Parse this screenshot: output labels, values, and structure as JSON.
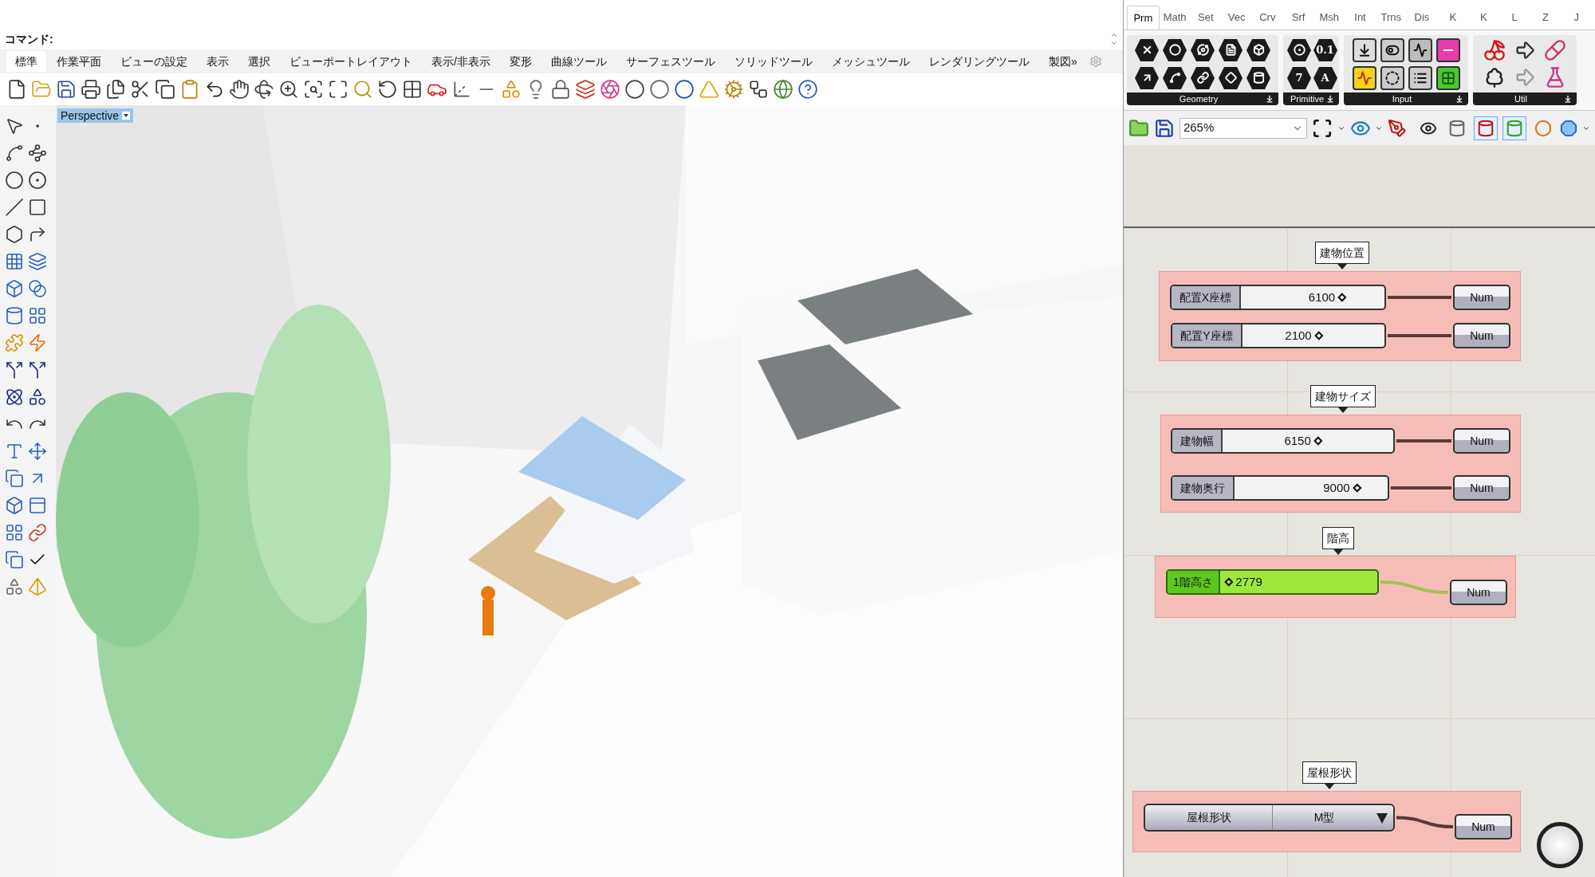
{
  "rhino": {
    "command_label": "コマンド:",
    "tabs": [
      {
        "label": "標準",
        "selected": true
      },
      {
        "label": "作業平面",
        "selected": false
      },
      {
        "label": "ビューの設定",
        "selected": false
      },
      {
        "label": "表示",
        "selected": false
      },
      {
        "label": "選択",
        "selected": false
      },
      {
        "label": "ビューポートレイアウト",
        "selected": false
      },
      {
        "label": "表示/非表示",
        "selected": false
      },
      {
        "label": "変形",
        "selected": false
      },
      {
        "label": "曲線ツール",
        "selected": false
      },
      {
        "label": "サーフェスツール",
        "selected": false
      },
      {
        "label": "ソリッドツール",
        "selected": false
      },
      {
        "label": "メッシュツール",
        "selected": false
      },
      {
        "label": "レンダリングツール",
        "selected": false
      },
      {
        "label": "製図»",
        "selected": false
      }
    ],
    "viewport": {
      "label": "Perspective"
    }
  },
  "grasshopper": {
    "tabs": [
      {
        "label": "Prm",
        "selected": true
      },
      {
        "label": "Math",
        "selected": false
      },
      {
        "label": "Set",
        "selected": false
      },
      {
        "label": "Vec",
        "selected": false
      },
      {
        "label": "Crv",
        "selected": false
      },
      {
        "label": "Srf",
        "selected": false
      },
      {
        "label": "Msh",
        "selected": false
      },
      {
        "label": "Int",
        "selected": false
      },
      {
        "label": "Trns",
        "selected": false
      },
      {
        "label": "Dis",
        "selected": false
      },
      {
        "label": "K",
        "selected": false
      },
      {
        "label": "K",
        "selected": false
      },
      {
        "label": "L",
        "selected": false
      },
      {
        "label": "Z",
        "selected": false
      },
      {
        "label": "J",
        "selected": false
      }
    ],
    "ribbon": [
      {
        "title": "Geometry"
      },
      {
        "title": "Primitive",
        "glyphs": [
          "0.1",
          "7",
          "A"
        ]
      },
      {
        "title": "Input"
      },
      {
        "title": "Util"
      }
    ],
    "zoom": "265%",
    "preview_modes": [
      {
        "selected": false
      },
      {
        "selected": false
      },
      {
        "selected": true
      },
      {
        "selected": true
      },
      {
        "selected": false
      }
    ],
    "groups": [
      {
        "tag": "建物位置",
        "nodes": [
          {
            "kind": "slider",
            "label": "配置X座標",
            "value": "6100",
            "selected": false,
            "output": "Num"
          },
          {
            "kind": "slider",
            "label": "配置Y座標",
            "value": "2100",
            "selected": false,
            "output": "Num"
          }
        ]
      },
      {
        "tag": "建物サイズ",
        "nodes": [
          {
            "kind": "slider",
            "label": "建物幅",
            "value": "6150",
            "selected": false,
            "output": "Num"
          },
          {
            "kind": "slider",
            "label": "建物奥行",
            "value": "9000",
            "selected": false,
            "output": "Num"
          }
        ]
      },
      {
        "tag": "階高",
        "nodes": [
          {
            "kind": "slider",
            "label": "1階高さ",
            "value": "2779",
            "selected": true,
            "output": "Num"
          }
        ]
      },
      {
        "tag": "屋根形状",
        "nodes": [
          {
            "kind": "valuelist",
            "label": "屋根形状",
            "value": "M型",
            "selected": false,
            "output": "Num"
          }
        ]
      }
    ]
  }
}
